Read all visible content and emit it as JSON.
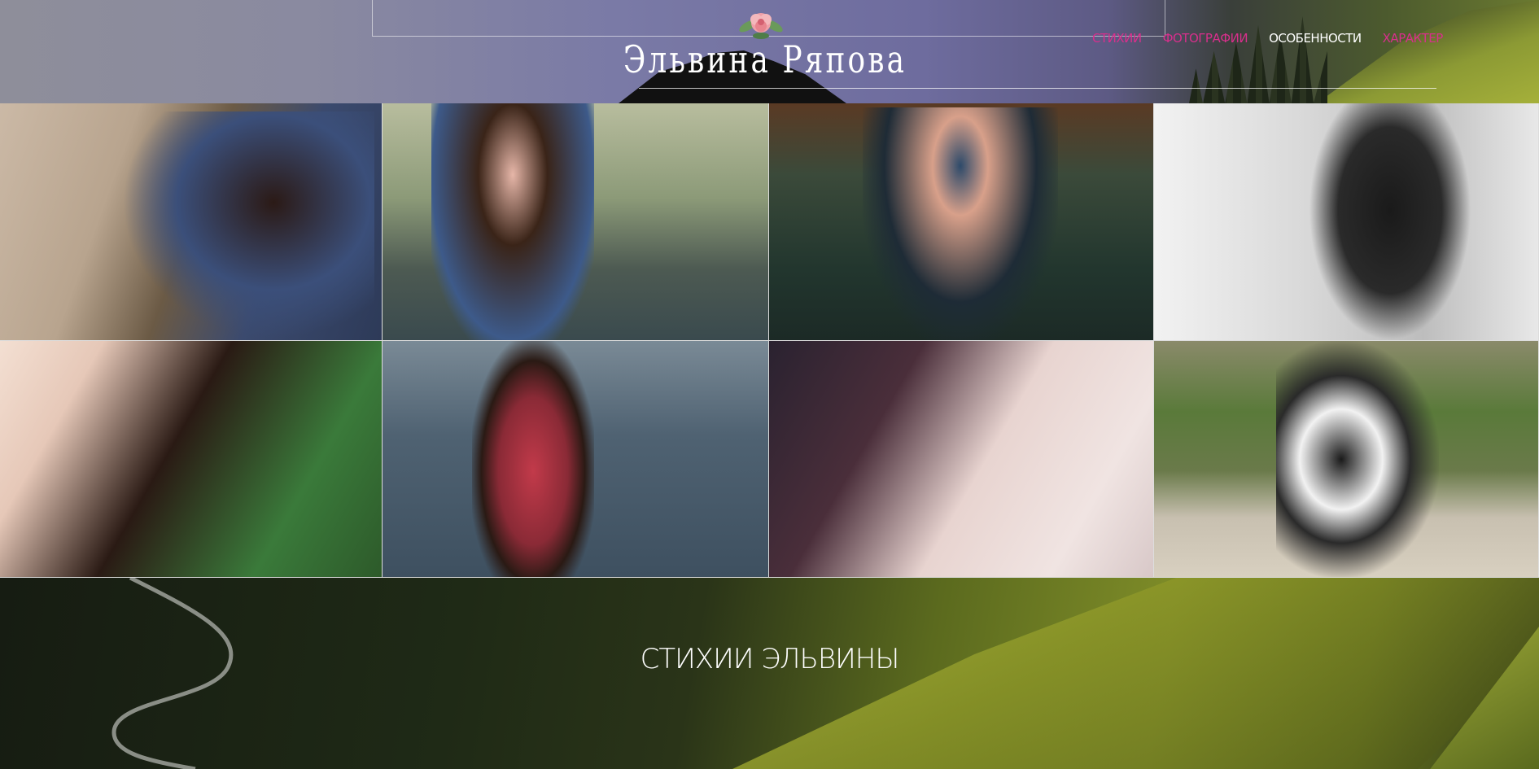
{
  "header": {
    "site_title": "Эльвина Ряпова",
    "nav": [
      {
        "label": "СТИХИИ",
        "color": "#d82f8c"
      },
      {
        "label": "ФОТОГРАФИИ",
        "color": "#d82f8c"
      },
      {
        "label": "ОСОБЕННОСТИ",
        "color": "#ffffff"
      },
      {
        "label": "ХАРАКТЕР",
        "color": "#d82f8c"
      }
    ]
  },
  "gallery": {
    "photos": [
      {
        "name": "portrait-lying-denim"
      },
      {
        "name": "portrait-waterfall"
      },
      {
        "name": "portrait-winter-hat"
      },
      {
        "name": "portrait-black-white"
      },
      {
        "name": "portrait-leaves"
      },
      {
        "name": "portrait-sea"
      },
      {
        "name": "portrait-closeup"
      },
      {
        "name": "portrait-hug-landscape"
      }
    ]
  },
  "section": {
    "title": "СТИХИИ ЭЛЬВИНЫ"
  },
  "colors": {
    "accent": "#d82f8c"
  }
}
